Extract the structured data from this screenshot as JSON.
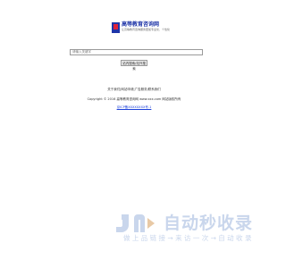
{
  "logo": {
    "title": "高等教育咨询网",
    "subtitle": "让高等教育咨询服务更加专业化、个性化"
  },
  "search": {
    "placeholder": "请输入关键字",
    "button_label": "站内搜索/站外搜索"
  },
  "footer": {
    "links": [
      {
        "label": "关于我们"
      },
      {
        "label": "网站申请"
      },
      {
        "label": "广告服务"
      },
      {
        "label": "联系我们"
      }
    ],
    "copyright": "Copyright © 2016 高等教育咨询网 www.xxx.com 网站版权所有",
    "icp": "京ICP备XXXXXXXX号-1"
  },
  "watermark": {
    "title": "自动秒收录",
    "subtitle": "做 上 品 链 接 → 来 访 一 次 → 自 动 收 录"
  },
  "colors": {
    "brand_blue": "#1f35a8",
    "brand_red": "#e0213a",
    "link_blue": "#1a3fd9",
    "watermark": "#c9d6ec"
  }
}
